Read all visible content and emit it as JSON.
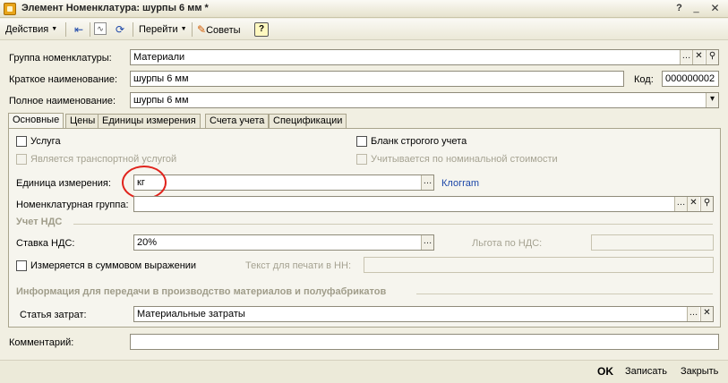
{
  "window": {
    "title": "Элемент Номенклатура: шурпы 6 мм *"
  },
  "toolbar": {
    "actions_label": "Действия",
    "goto_label": "Перейти",
    "tips_label": "Советы",
    "help_label": "?"
  },
  "header": {
    "group_label": "Группа номенклатуры:",
    "group_value": "Материали",
    "short_name_label": "Краткое наименование:",
    "short_name_value": "шурпы 6 мм",
    "code_label": "Код:",
    "code_value": "000000002",
    "full_name_label": "Полное наименование:",
    "full_name_value": "шурпы 6 мм"
  },
  "tabs": [
    {
      "label": "Основные"
    },
    {
      "label": "Цены"
    },
    {
      "label": "Единицы измерения"
    },
    {
      "label": "Счета учета"
    },
    {
      "label": "Спецификации"
    }
  ],
  "main": {
    "service_label": "Услуга",
    "transport_label": "Является транспортной услугой",
    "strict_blank_label": "Бланк строгого учета",
    "nominal_label": "Учитывается по номинальной стоимости",
    "unit_label": "Единица измерения:",
    "unit_value": "кг",
    "unit_link": "Клогram",
    "nomenclature_group_label": "Номенклатурная группа:",
    "nomenclature_group_value": "",
    "vat_section": "Учет НДС",
    "vat_rate_label": "Ставка НДС:",
    "vat_rate_value": "20%",
    "vat_benefit_label": "Льгота по НДС:",
    "sum_label": "Измеряется в суммовом выражении",
    "print_text_label": "Текст для печати в НН:",
    "production_section": "Информация для передачи в производство материалов и полуфабрикатов",
    "cost_item_label": "Статья затрат:",
    "cost_item_value": "Материальные затраты"
  },
  "comment": {
    "label": "Комментарий:",
    "value": ""
  },
  "footer": {
    "ok_label": "OK",
    "save_label": "Записать",
    "close_label": "Закрыть"
  }
}
